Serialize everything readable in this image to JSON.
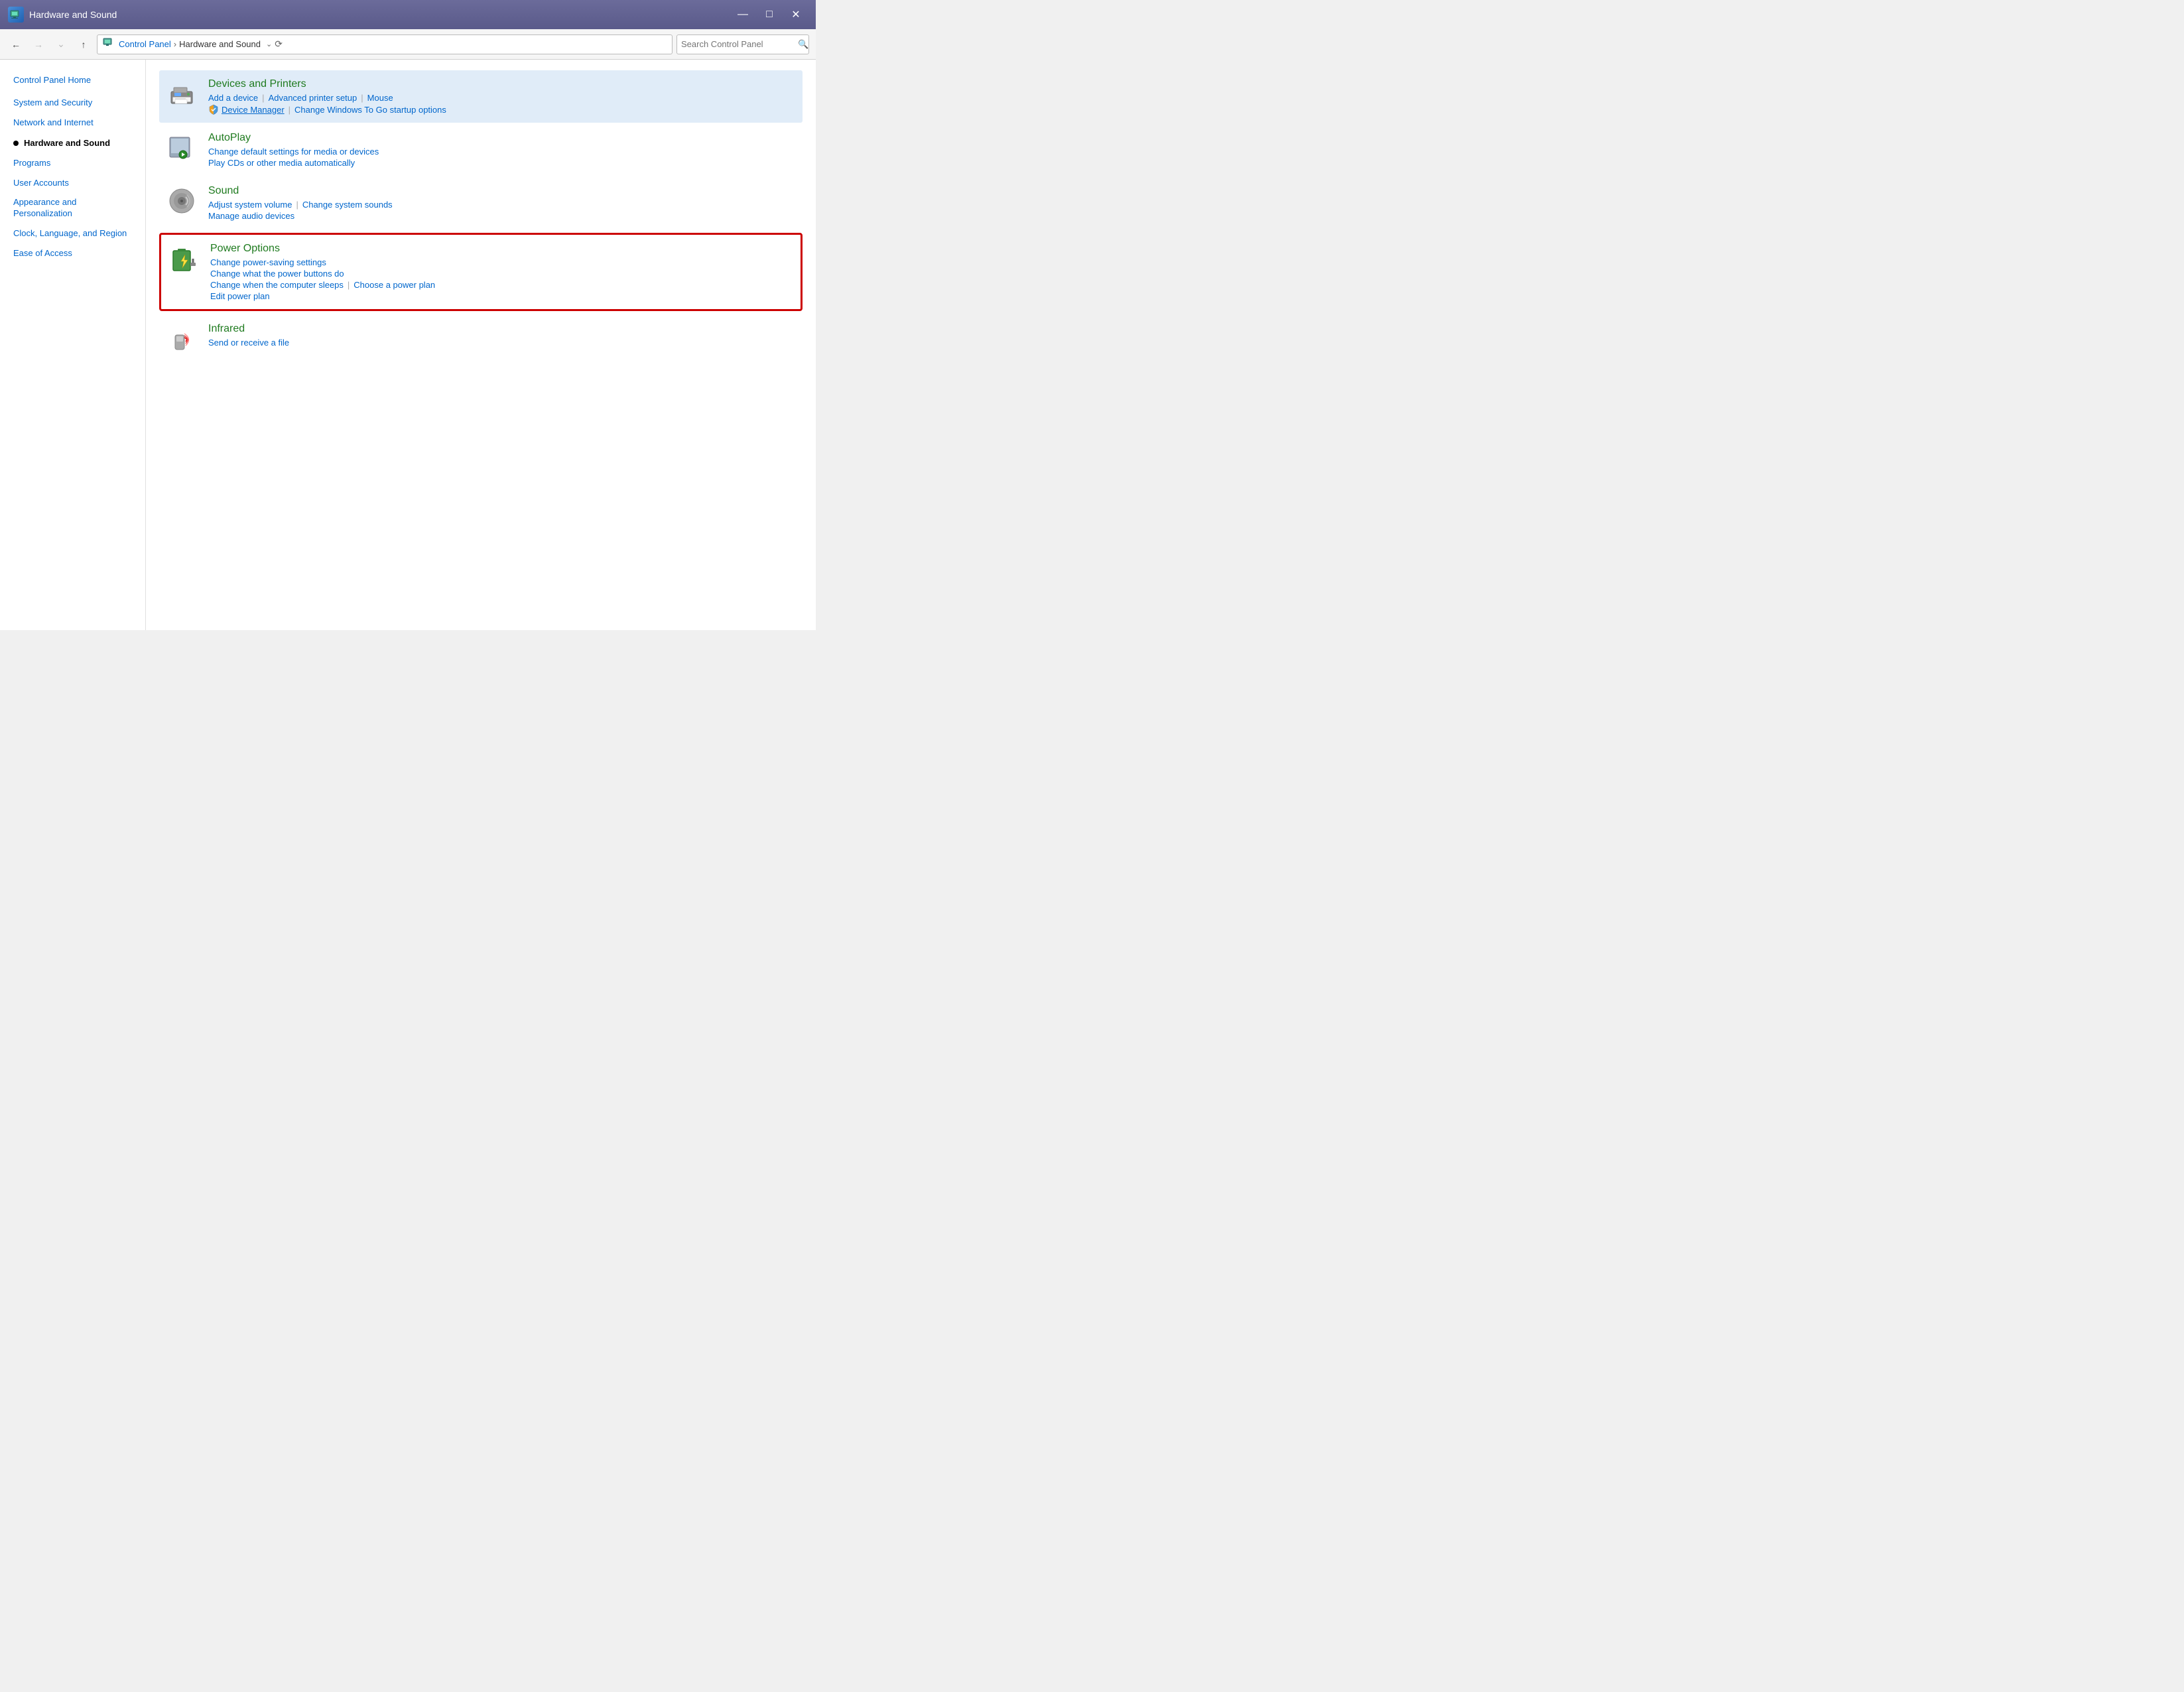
{
  "titleBar": {
    "title": "Hardware and Sound",
    "icon": "🖥"
  },
  "windowControls": {
    "minimize": "—",
    "maximize": "□",
    "close": "✕"
  },
  "addressBar": {
    "back": "←",
    "forward": "→",
    "dropDown": "∨",
    "up": "↑",
    "refresh": "⟳",
    "path": {
      "icon": "🖥",
      "segments": [
        "Control Panel",
        "Hardware and Sound"
      ]
    },
    "search": {
      "placeholder": "Search Control Panel",
      "icon": "🔍"
    }
  },
  "sidebar": {
    "items": [
      {
        "id": "control-panel-home",
        "label": "Control Panel Home",
        "active": false
      },
      {
        "id": "system-and-security",
        "label": "System and Security",
        "active": false
      },
      {
        "id": "network-and-internet",
        "label": "Network and Internet",
        "active": false
      },
      {
        "id": "hardware-and-sound",
        "label": "Hardware and Sound",
        "active": true
      },
      {
        "id": "programs",
        "label": "Programs",
        "active": false
      },
      {
        "id": "user-accounts",
        "label": "User Accounts",
        "active": false
      },
      {
        "id": "appearance-and-personalization",
        "label": "Appearance and\nPersonalization",
        "active": false
      },
      {
        "id": "clock-language-and-region",
        "label": "Clock, Language, and Region",
        "active": false
      },
      {
        "id": "ease-of-access",
        "label": "Ease of Access",
        "active": false
      }
    ]
  },
  "sections": [
    {
      "id": "devices-and-printers",
      "title": "Devices and Printers",
      "highlighted": true,
      "icon": "devices",
      "links": [
        {
          "id": "add-a-device",
          "label": "Add a device"
        },
        {
          "id": "advanced-printer-setup",
          "label": "Advanced printer setup"
        },
        {
          "id": "mouse",
          "label": "Mouse"
        }
      ],
      "links2": [
        {
          "id": "device-manager",
          "label": "Device Manager",
          "shield": true
        },
        {
          "id": "change-windows-to-go",
          "label": "Change Windows To Go startup options"
        }
      ]
    },
    {
      "id": "autoplay",
      "title": "AutoPlay",
      "highlighted": false,
      "icon": "autoplay",
      "links": [
        {
          "id": "change-default-settings",
          "label": "Change default settings for media or devices"
        }
      ],
      "links2": [
        {
          "id": "play-cds",
          "label": "Play CDs or other media automatically"
        }
      ]
    },
    {
      "id": "sound",
      "title": "Sound",
      "highlighted": false,
      "icon": "sound",
      "links": [
        {
          "id": "adjust-system-volume",
          "label": "Adjust system volume"
        },
        {
          "id": "change-system-sounds",
          "label": "Change system sounds"
        }
      ],
      "links2": [
        {
          "id": "manage-audio-devices",
          "label": "Manage audio devices"
        }
      ]
    },
    {
      "id": "power-options",
      "title": "Power Options",
      "highlighted": false,
      "highlightedRed": true,
      "icon": "power",
      "links": [
        {
          "id": "change-power-saving",
          "label": "Change power-saving settings"
        }
      ],
      "links2": [
        {
          "id": "change-power-buttons",
          "label": "Change what the power buttons do"
        }
      ],
      "links3": [
        {
          "id": "change-when-computer-sleeps",
          "label": "Change when the computer sleeps"
        },
        {
          "id": "choose-a-power-plan",
          "label": "Choose a power plan"
        }
      ],
      "links4": [
        {
          "id": "edit-power-plan",
          "label": "Edit power plan"
        }
      ]
    },
    {
      "id": "infrared",
      "title": "Infrared",
      "highlighted": false,
      "icon": "infrared",
      "links": [
        {
          "id": "send-or-receive",
          "label": "Send or receive a file"
        }
      ]
    }
  ]
}
